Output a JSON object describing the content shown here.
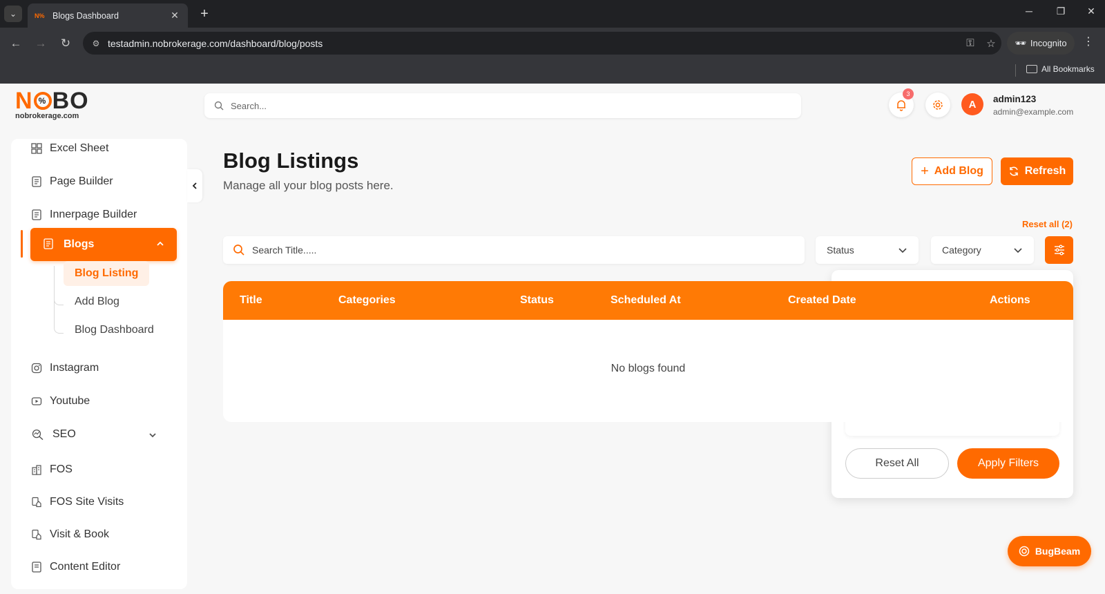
{
  "browser": {
    "tab_title": "Blogs Dashboard",
    "favicon_text": "N%",
    "url": "testadmin.nobrokerage.com/dashboard/blog/posts",
    "incognito_label": "Incognito",
    "bookmarks_label": "All Bookmarks"
  },
  "header": {
    "logo_main_left": "N",
    "logo_main_right": "BO",
    "logo_sub": "nobrokerage.com",
    "search_placeholder": "Search...",
    "notification_count": "3",
    "avatar_initial": "A",
    "user_name": "admin123",
    "user_email": "admin@example.com"
  },
  "sidebar": {
    "items_top": [
      {
        "label": "Excel Sheet",
        "icon": "grid-icon"
      },
      {
        "label": "Page Builder",
        "icon": "document-icon"
      },
      {
        "label": "Innerpage Builder",
        "icon": "document-icon"
      }
    ],
    "active": {
      "label": "Blogs",
      "icon": "document-icon"
    },
    "sub_items": [
      {
        "label": "Blog Listing",
        "active": true
      },
      {
        "label": "Add Blog",
        "active": false
      },
      {
        "label": "Blog Dashboard",
        "active": false
      }
    ],
    "items_bottom": [
      {
        "label": "Instagram",
        "icon": "instagram-icon"
      },
      {
        "label": "Youtube",
        "icon": "youtube-icon"
      },
      {
        "label": "SEO",
        "icon": "seo-icon"
      },
      {
        "label": "FOS",
        "icon": "building-icon"
      },
      {
        "label": "FOS Site Visits",
        "icon": "site-visit-icon"
      },
      {
        "label": "Visit & Book",
        "icon": "site-visit-icon"
      },
      {
        "label": "Content Editor",
        "icon": "document-icon"
      }
    ]
  },
  "main": {
    "title": "Blog Listings",
    "subtitle": "Manage all your blog posts here.",
    "add_blog_label": "Add Blog",
    "refresh_label": "Refresh",
    "reset_all_link": "Reset all (2)",
    "title_search_placeholder": "Search Title.....",
    "status_select": "Status",
    "category_select": "Category",
    "table": {
      "columns": [
        "Title",
        "Categories",
        "Status",
        "Scheduled At",
        "Created Date",
        "Actions"
      ],
      "empty_message": "No blogs found"
    }
  },
  "filter_panel": {
    "reset_label": "Reset All",
    "apply_label": "Apply Filters"
  },
  "bugbeam_label": "BugBeam",
  "colors": {
    "accent": "#ff6a00",
    "chrome_dark": "#202124"
  }
}
